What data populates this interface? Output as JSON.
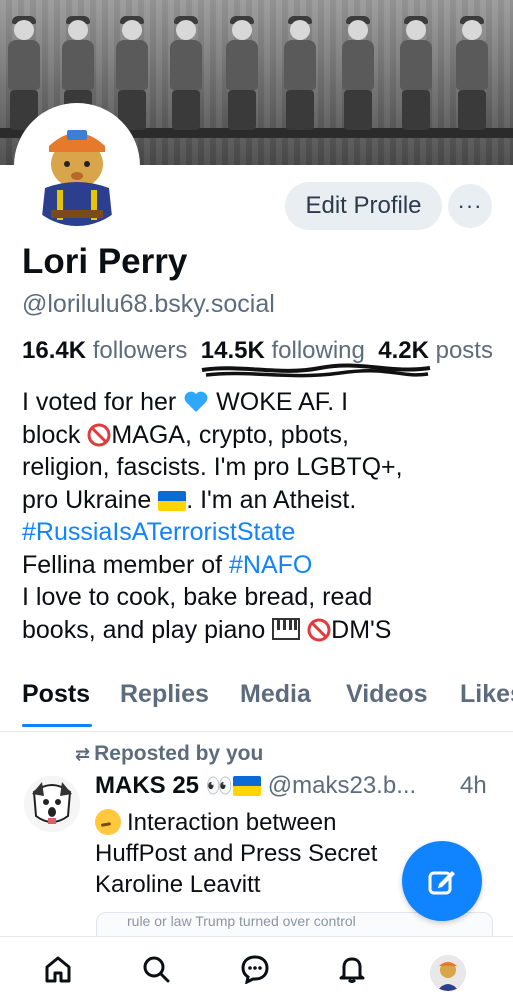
{
  "profile": {
    "name": "Lori Perry",
    "handle": "@lorilulu68.bsky.social",
    "edit_label": "Edit Profile",
    "more_label": "···"
  },
  "stats": {
    "followers_count": "16.4K",
    "followers_label": "followers",
    "following_count": "14.5K",
    "following_label": "following",
    "posts_count": "4.2K",
    "posts_label": "posts"
  },
  "bio": {
    "l1a": "I voted for her",
    "l1b": "WOKE AF. I",
    "l2a": "block",
    "l2b": "MAGA, crypto, pbots,",
    "l3": "religion, fascists. I'm pro LGBTQ+,",
    "l4a": "pro Ukraine",
    "l4b": ". I'm an Atheist.",
    "l5": "#RussiaIsATerroristState",
    "l6a": "Fellina member of",
    "l6b": "#NAFO",
    "l7": "I love to cook, bake bread, read",
    "l8a": "books, and play piano",
    "l8b": "DM'S"
  },
  "tabs": [
    "Posts",
    "Replies",
    "Media",
    "Videos",
    "Likes"
  ],
  "feed": {
    "repost_label": "Reposted by you",
    "author": "MAKS 25",
    "author_emoji": "👀",
    "handle": "@maks23.b...",
    "time": "4h",
    "text_l1": "Interaction between",
    "text_l2": "HuffPost and Press Secret",
    "text_l3": "Karoline Leavitt",
    "embed_text": "rule or law Trump turned over control"
  },
  "icons": {
    "repost": "repost-icon",
    "compose": "compose-icon",
    "home": "home-icon",
    "search": "search-icon",
    "chat": "chat-icon",
    "bell": "bell-icon"
  },
  "colors": {
    "accent": "#1083fe",
    "muted": "#5d6c7d",
    "button_bg": "#e9eef3"
  }
}
